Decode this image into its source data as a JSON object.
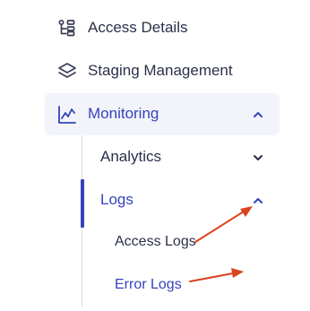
{
  "nav": {
    "access_details": "Access Details",
    "staging_management": "Staging Management",
    "monitoring": "Monitoring",
    "analytics": "Analytics",
    "logs": "Logs",
    "access_logs": "Access Logs",
    "error_logs": "Error Logs"
  },
  "colors": {
    "text": "#2b3049",
    "accent": "#3444b8",
    "annotation_arrow": "#d9431e"
  }
}
